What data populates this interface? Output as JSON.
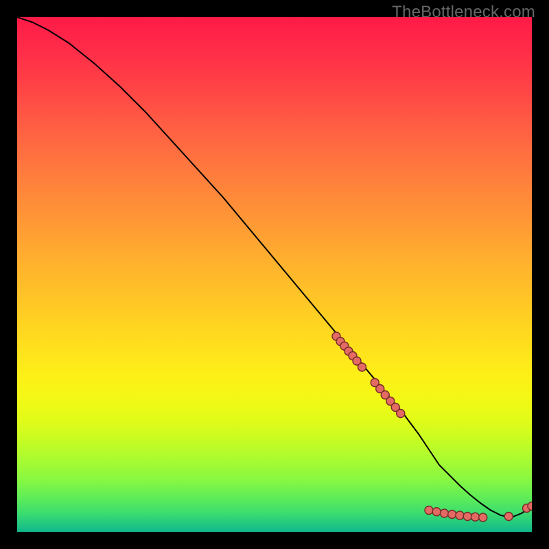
{
  "watermark": "TheBottleneck.com",
  "chart_data": {
    "type": "line",
    "title": "",
    "xlabel": "",
    "ylabel": "",
    "xlim": [
      0,
      100
    ],
    "ylim": [
      0,
      100
    ],
    "curve": {
      "name": "bottleneck-curve",
      "x": [
        0,
        3,
        6,
        10,
        15,
        20,
        25,
        30,
        35,
        40,
        45,
        50,
        55,
        60,
        65,
        70,
        75,
        78,
        80,
        82,
        84,
        86,
        88,
        90,
        92,
        94,
        96,
        98,
        100
      ],
      "y": [
        100,
        99,
        97.5,
        95,
        91,
        86.5,
        81.5,
        76,
        70.5,
        65,
        59,
        53,
        47,
        41,
        35,
        29,
        23,
        19,
        16,
        13,
        11,
        9,
        7.2,
        5.6,
        4.2,
        3.2,
        2.8,
        3.6,
        5.0
      ]
    },
    "point_groups": [
      {
        "name": "upper-descent-cluster",
        "points": [
          {
            "x": 62.0,
            "y": 38.0
          },
          {
            "x": 62.8,
            "y": 37.0
          },
          {
            "x": 63.6,
            "y": 36.1
          },
          {
            "x": 64.4,
            "y": 35.1
          },
          {
            "x": 65.2,
            "y": 34.2
          },
          {
            "x": 66.0,
            "y": 33.2
          },
          {
            "x": 67.0,
            "y": 32.0
          }
        ]
      },
      {
        "name": "mid-descent-cluster",
        "points": [
          {
            "x": 69.5,
            "y": 29.0
          },
          {
            "x": 70.5,
            "y": 27.8
          },
          {
            "x": 71.5,
            "y": 26.6
          },
          {
            "x": 72.5,
            "y": 25.4
          },
          {
            "x": 73.5,
            "y": 24.2
          },
          {
            "x": 74.5,
            "y": 23.0
          }
        ]
      },
      {
        "name": "bottom-flat-cluster",
        "points": [
          {
            "x": 80.0,
            "y": 4.2
          },
          {
            "x": 81.5,
            "y": 3.9
          },
          {
            "x": 83.0,
            "y": 3.6
          },
          {
            "x": 84.5,
            "y": 3.4
          },
          {
            "x": 86.0,
            "y": 3.2
          },
          {
            "x": 87.5,
            "y": 3.0
          },
          {
            "x": 89.0,
            "y": 2.9
          },
          {
            "x": 90.5,
            "y": 2.8
          }
        ]
      },
      {
        "name": "tail-gap-point",
        "points": [
          {
            "x": 95.5,
            "y": 3.0
          }
        ]
      },
      {
        "name": "right-up-pair",
        "points": [
          {
            "x": 99.0,
            "y": 4.6
          },
          {
            "x": 100.0,
            "y": 5.0
          }
        ]
      }
    ],
    "marker": {
      "shape": "circle",
      "radius_px": 6,
      "fill": "#e46a64",
      "stroke": "#742b27",
      "stroke_width": 1.4
    },
    "line_style": {
      "stroke": "#000000",
      "width": 2
    }
  }
}
